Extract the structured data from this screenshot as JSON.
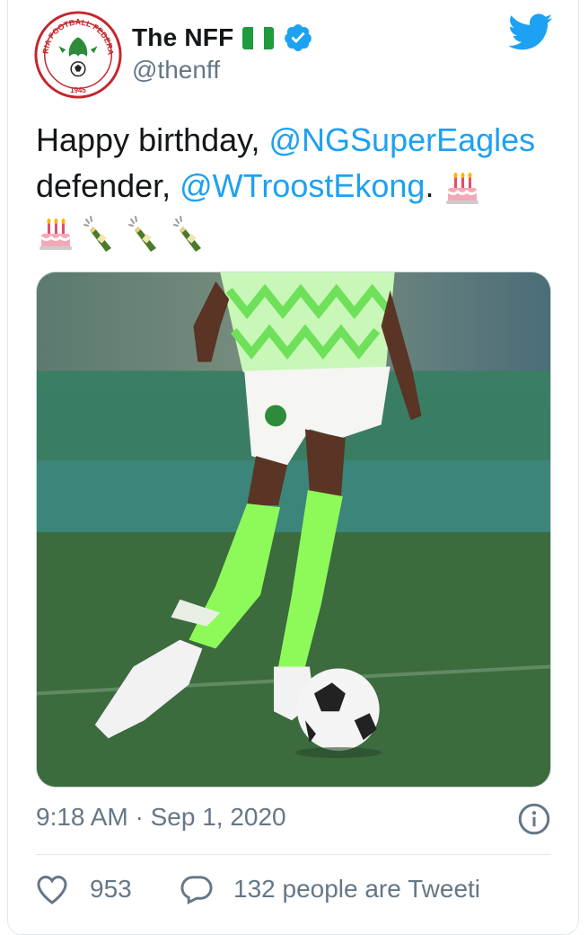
{
  "author": {
    "display_name": "The NFF",
    "handle": "@thenff",
    "logo_text_top": "NIGERIA FOOTBALL FEDERATION",
    "logo_year": "1945",
    "verified": true,
    "flag": "nigeria-flag"
  },
  "tweet": {
    "text_part1": "Happy birthday, ",
    "mention1": "@NGSuperEagles",
    "text_part2": " defender, ",
    "mention2": "@WTroostEkong",
    "text_part3": ". ",
    "emojis": [
      "birthday-cake",
      "birthday-cake",
      "champagne",
      "champagne",
      "champagne"
    ]
  },
  "media": {
    "description": "footballer-in-green-kit-with-ball"
  },
  "meta": {
    "timestamp": "9:18 AM · Sep 1, 2020"
  },
  "actions": {
    "likes": "953",
    "retweet_text": "132 people are Tweeti"
  },
  "colors": {
    "link": "#1da1f2",
    "secondary_text": "#657786",
    "nigeria_green": "#008751",
    "kit_green": "#8dfa5a"
  }
}
